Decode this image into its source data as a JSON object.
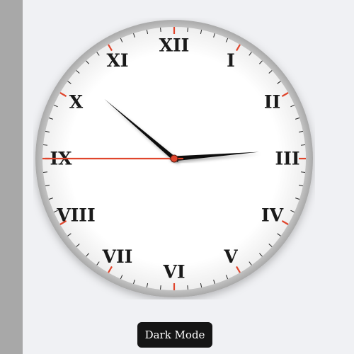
{
  "clock": {
    "numerals": [
      "XII",
      "I",
      "II",
      "III",
      "IV",
      "V",
      "VI",
      "VII",
      "VIII",
      "IX",
      "X",
      "XI"
    ],
    "time": {
      "hour": 2,
      "minute": 51,
      "second": 45
    },
    "colors": {
      "face": "#ffffff",
      "bezel": "#c9c9c9",
      "numeral": "#1a1a1a",
      "hands": "#111111",
      "second_hand": "#e0452c",
      "hour_marker": "#e0452c",
      "tick": "#222222"
    }
  },
  "controls": {
    "dark_mode_label": "Dark Mode"
  }
}
